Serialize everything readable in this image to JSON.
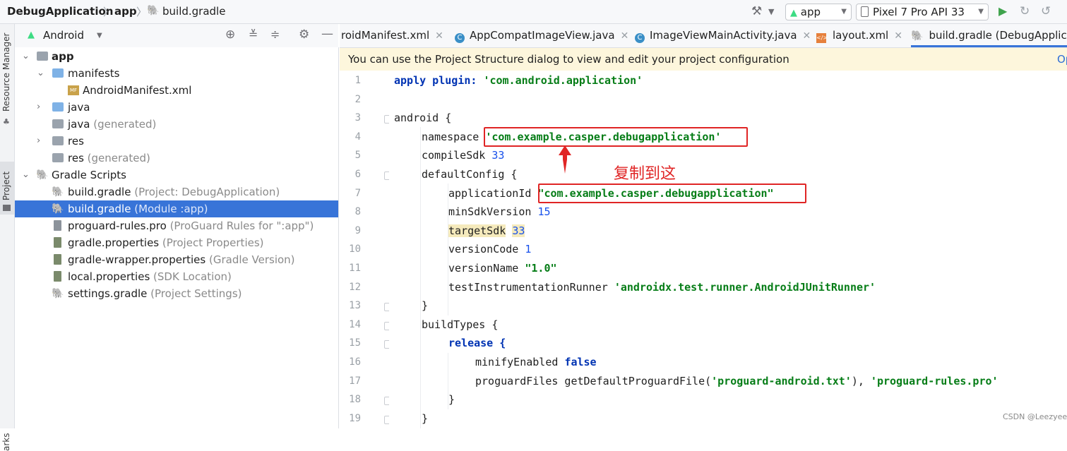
{
  "breadcrumb": {
    "project": "DebugApplication",
    "module": "app",
    "file": "build.gradle"
  },
  "toolbar": {
    "hammer_icon": "hammer-icon",
    "config_select": "app",
    "device_select": "Pixel 7 Pro API 33",
    "run_icon": "run-icon",
    "rerun_icon": "apply-changes-icon"
  },
  "left_strip": {
    "resource_manager": "Resource Manager",
    "project": "Project",
    "bookmarks": "arks"
  },
  "project_panel": {
    "view_select": "Android",
    "tree": [
      {
        "label": "app",
        "extra": "",
        "icon": "module-folder-icon"
      },
      {
        "label": "manifests",
        "extra": "",
        "icon": "folder-icon"
      },
      {
        "label": "AndroidManifest.xml",
        "extra": "",
        "icon": "manifest-file-icon"
      },
      {
        "label": "java",
        "extra": "",
        "icon": "folder-icon"
      },
      {
        "label": "java",
        "extra": "(generated)",
        "icon": "generated-folder-icon"
      },
      {
        "label": "res",
        "extra": "",
        "icon": "res-folder-icon"
      },
      {
        "label": "res",
        "extra": "(generated)",
        "icon": "res-folder-icon"
      },
      {
        "label": "Gradle Scripts",
        "extra": "",
        "icon": "gradle-icon"
      },
      {
        "label": "build.gradle",
        "extra": "(Project: DebugApplication)",
        "icon": "gradle-icon"
      },
      {
        "label": "build.gradle",
        "extra": "(Module :app)",
        "icon": "gradle-icon"
      },
      {
        "label": "proguard-rules.pro",
        "extra": "(ProGuard Rules for \":app\")",
        "icon": "file-icon"
      },
      {
        "label": "gradle.properties",
        "extra": "(Project Properties)",
        "icon": "properties-icon"
      },
      {
        "label": "gradle-wrapper.properties",
        "extra": "(Gradle Version)",
        "icon": "properties-icon"
      },
      {
        "label": "local.properties",
        "extra": "(SDK Location)",
        "icon": "properties-icon"
      },
      {
        "label": "settings.gradle",
        "extra": "(Project Settings)",
        "icon": "gradle-icon"
      }
    ]
  },
  "tabs": [
    {
      "label": "roidManifest.xml"
    },
    {
      "label": "AppCompatImageView.java"
    },
    {
      "label": "ImageViewMainActivity.java"
    },
    {
      "label": "layout.xml"
    },
    {
      "label": "build.gradle (DebugApplicat"
    }
  ],
  "banner": {
    "text": "You can use the Project Structure dialog to view and edit your project configuration",
    "link": "Op"
  },
  "code": {
    "line_numbers": [
      "1",
      "2",
      "3",
      "4",
      "5",
      "6",
      "7",
      "8",
      "9",
      "10",
      "11",
      "12",
      "13",
      "14",
      "15",
      "16",
      "17",
      "18",
      "19"
    ],
    "l1_kw": "apply plugin:",
    "l1_str": "'com.android.application'",
    "l3": "android {",
    "l4_a": "namespace ",
    "l4_str": "'com.example.casper.debugapplication'",
    "l5_a": "compileSdk ",
    "l5_num": "33",
    "l6": "defaultConfig {",
    "l7_a": "applicationId ",
    "l7_str": "\"com.example.casper.debugapplication\"",
    "l8_a": "minSdkVersion ",
    "l8_num": "15",
    "l9_a": "targetSdk",
    "l9_num": "33",
    "l10_a": "versionCode ",
    "l10_num": "1",
    "l11_a": "versionName ",
    "l11_str": "\"1.0\"",
    "l12_a": "testInstrumentationRunner ",
    "l12_str": "'androidx.test.runner.AndroidJUnitRunner'",
    "l13": "}",
    "l14": "buildTypes {",
    "l15": "release {",
    "l16_a": "minifyEnabled ",
    "l16_kw": "false",
    "l17_a": "proguardFiles getDefaultProguardFile(",
    "l17_str1": "'proguard-android.txt'",
    "l17_b": "), ",
    "l17_str2": "'proguard-rules.pro'",
    "l18": "}",
    "l19": "}"
  },
  "annotation": {
    "note": "复制到这"
  },
  "watermark": "CSDN @Leezyee"
}
